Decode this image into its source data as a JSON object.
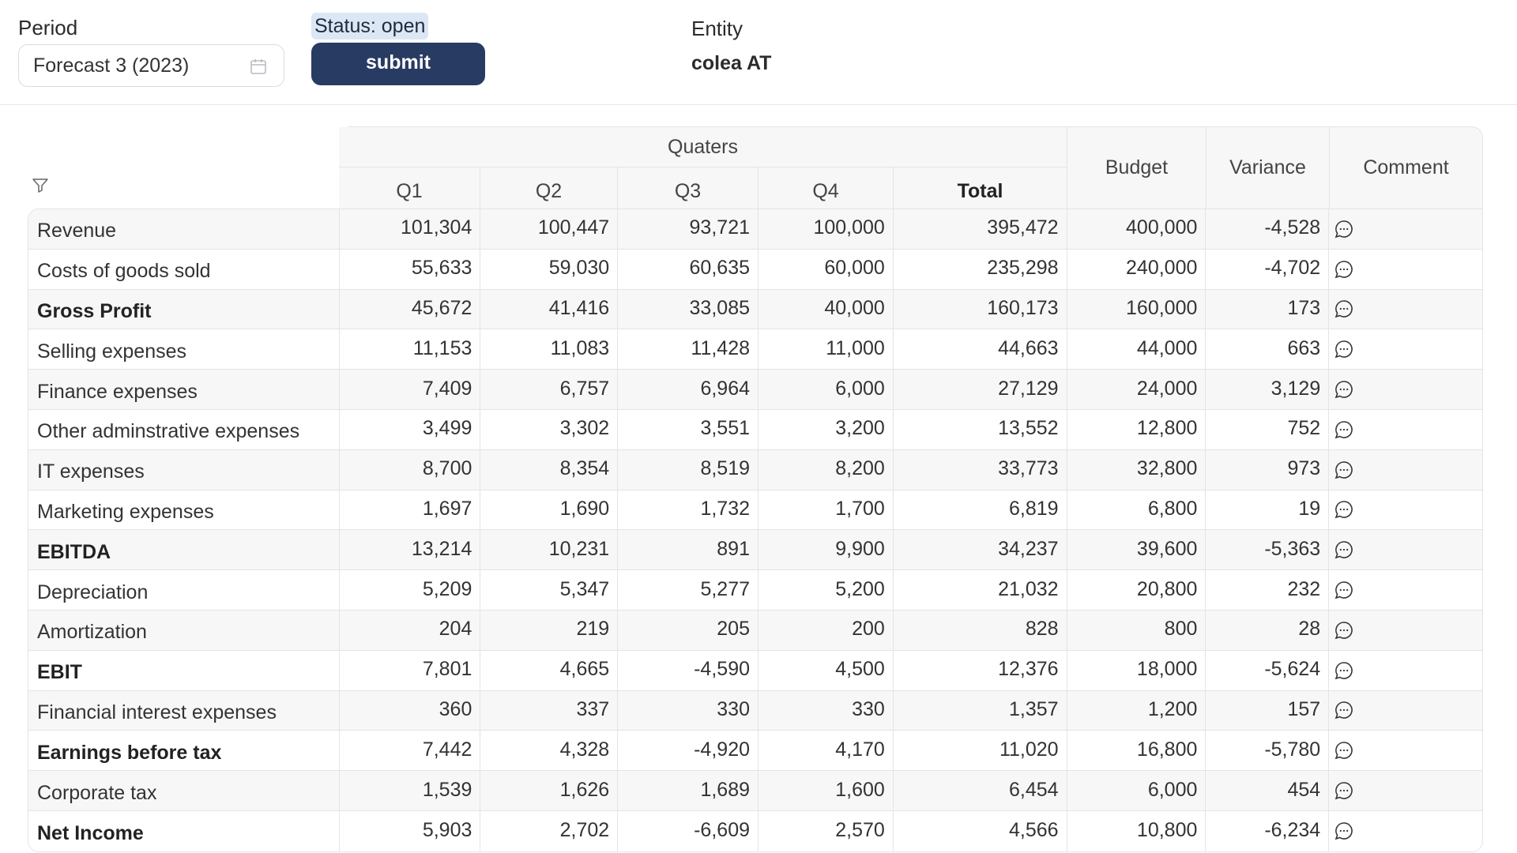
{
  "toolbar": {
    "period_label": "Period",
    "period_value": "Forecast 3 (2023)",
    "status": "Status: open",
    "submit_label": "submit",
    "entity_label": "Entity",
    "entity_value": "colea AT"
  },
  "table": {
    "group_header": "Quaters",
    "columns": {
      "q1": "Q1",
      "q2": "Q2",
      "q3": "Q3",
      "q4": "Q4",
      "total": "Total",
      "budget": "Budget",
      "variance": "Variance",
      "comment": "Comment"
    },
    "rows": [
      {
        "label": "Revenue",
        "bold": false,
        "q1": "101,304",
        "q2": "100,447",
        "q3": "93,721",
        "q4": "100,000",
        "total": "395,472",
        "budget": "400,000",
        "variance": "-4,528"
      },
      {
        "label": "Costs of goods sold",
        "bold": false,
        "q1": "55,633",
        "q2": "59,030",
        "q3": "60,635",
        "q4": "60,000",
        "total": "235,298",
        "budget": "240,000",
        "variance": "-4,702"
      },
      {
        "label": "Gross Profit",
        "bold": true,
        "q1": "45,672",
        "q2": "41,416",
        "q3": "33,085",
        "q4": "40,000",
        "total": "160,173",
        "budget": "160,000",
        "variance": "173"
      },
      {
        "label": "Selling expenses",
        "bold": false,
        "q1": "11,153",
        "q2": "11,083",
        "q3": "11,428",
        "q4": "11,000",
        "total": "44,663",
        "budget": "44,000",
        "variance": "663"
      },
      {
        "label": "Finance expenses",
        "bold": false,
        "q1": "7,409",
        "q2": "6,757",
        "q3": "6,964",
        "q4": "6,000",
        "total": "27,129",
        "budget": "24,000",
        "variance": "3,129"
      },
      {
        "label": "Other adminstrative expenses",
        "bold": false,
        "q1": "3,499",
        "q2": "3,302",
        "q3": "3,551",
        "q4": "3,200",
        "total": "13,552",
        "budget": "12,800",
        "variance": "752"
      },
      {
        "label": "IT expenses",
        "bold": false,
        "q1": "8,700",
        "q2": "8,354",
        "q3": "8,519",
        "q4": "8,200",
        "total": "33,773",
        "budget": "32,800",
        "variance": "973"
      },
      {
        "label": "Marketing expenses",
        "bold": false,
        "q1": "1,697",
        "q2": "1,690",
        "q3": "1,732",
        "q4": "1,700",
        "total": "6,819",
        "budget": "6,800",
        "variance": "19"
      },
      {
        "label": "EBITDA",
        "bold": true,
        "q1": "13,214",
        "q2": "10,231",
        "q3": "891",
        "q4": "9,900",
        "total": "34,237",
        "budget": "39,600",
        "variance": "-5,363"
      },
      {
        "label": "Depreciation",
        "bold": false,
        "q1": "5,209",
        "q2": "5,347",
        "q3": "5,277",
        "q4": "5,200",
        "total": "21,032",
        "budget": "20,800",
        "variance": "232"
      },
      {
        "label": "Amortization",
        "bold": false,
        "q1": "204",
        "q2": "219",
        "q3": "205",
        "q4": "200",
        "total": "828",
        "budget": "800",
        "variance": "28"
      },
      {
        "label": "EBIT",
        "bold": true,
        "q1": "7,801",
        "q2": "4,665",
        "q3": "-4,590",
        "q4": "4,500",
        "total": "12,376",
        "budget": "18,000",
        "variance": "-5,624"
      },
      {
        "label": "Financial interest expenses",
        "bold": false,
        "q1": "360",
        "q2": "337",
        "q3": "330",
        "q4": "330",
        "total": "1,357",
        "budget": "1,200",
        "variance": "157"
      },
      {
        "label": "Earnings before tax",
        "bold": true,
        "q1": "7,442",
        "q2": "4,328",
        "q3": "-4,920",
        "q4": "4,170",
        "total": "11,020",
        "budget": "16,800",
        "variance": "-5,780"
      },
      {
        "label": "Corporate tax",
        "bold": false,
        "q1": "1,539",
        "q2": "1,626",
        "q3": "1,689",
        "q4": "1,600",
        "total": "6,454",
        "budget": "6,000",
        "variance": "454"
      },
      {
        "label": "Net Income",
        "bold": true,
        "q1": "5,903",
        "q2": "2,702",
        "q3": "-6,609",
        "q4": "2,570",
        "total": "4,566",
        "budget": "10,800",
        "variance": "-6,234"
      }
    ]
  },
  "icons": {
    "period": "calendar-icon",
    "filter": "filter-icon",
    "comment": "comment-icon"
  },
  "colors": {
    "accent": "#283b63",
    "status_bg": "#dbe7f5",
    "shaded_row": "#f7f7f8",
    "border": "#e2e4e8"
  }
}
